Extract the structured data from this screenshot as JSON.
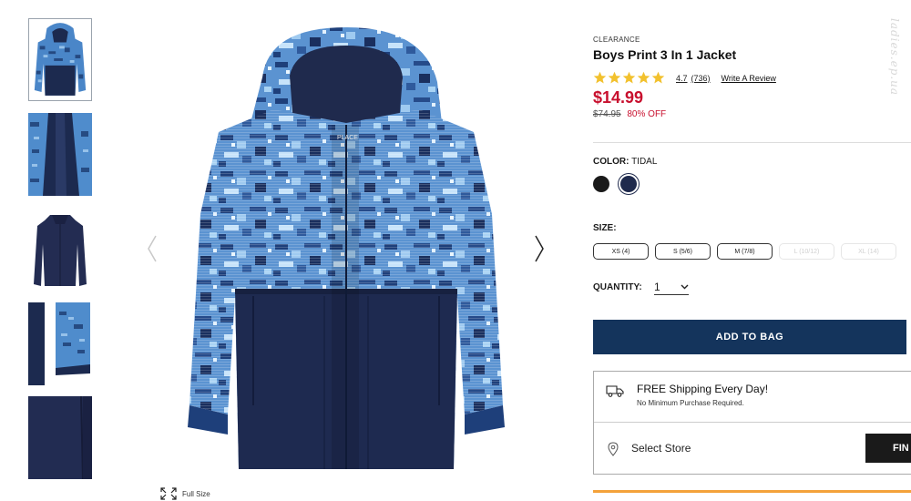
{
  "product": {
    "badge": "CLEARANCE",
    "title": "Boys Print 3 In 1 Jacket",
    "rating": "4.7",
    "review_count": "(736)",
    "write_review": "Write A Review",
    "stars_filled": 5,
    "price": "$14.99",
    "original_price": "$74.95",
    "discount": "80% OFF"
  },
  "color": {
    "label": "COLOR:",
    "selected": "TIDAL",
    "swatches": [
      {
        "name": "black",
        "hex": "#1a1a1a"
      },
      {
        "name": "tidal",
        "hex": "#1f2a4d"
      }
    ]
  },
  "size": {
    "label": "SIZE:",
    "options": [
      {
        "label": "XS (4)",
        "available": true
      },
      {
        "label": "S (5/6)",
        "available": true
      },
      {
        "label": "M (7/8)",
        "available": true
      },
      {
        "label": "L (10/12)",
        "available": false
      },
      {
        "label": "XL (14)",
        "available": false
      }
    ]
  },
  "quantity": {
    "label": "QUANTITY:",
    "value": "1"
  },
  "add_to_bag": "ADD TO BAG",
  "shipping": {
    "title": "FREE Shipping Every Day!",
    "subtitle": "No Minimum Purchase Required.",
    "store_label": "Select Store",
    "find_button": "FIN"
  },
  "gallery": {
    "full_size_label": "Full Size",
    "thumbnail_count": 5
  },
  "watermark": "ladies.ep.ua",
  "colors": {
    "accent_red": "#c8102e",
    "navy": "#14345c",
    "star": "#f2c12e",
    "orange": "#f4a23a"
  }
}
